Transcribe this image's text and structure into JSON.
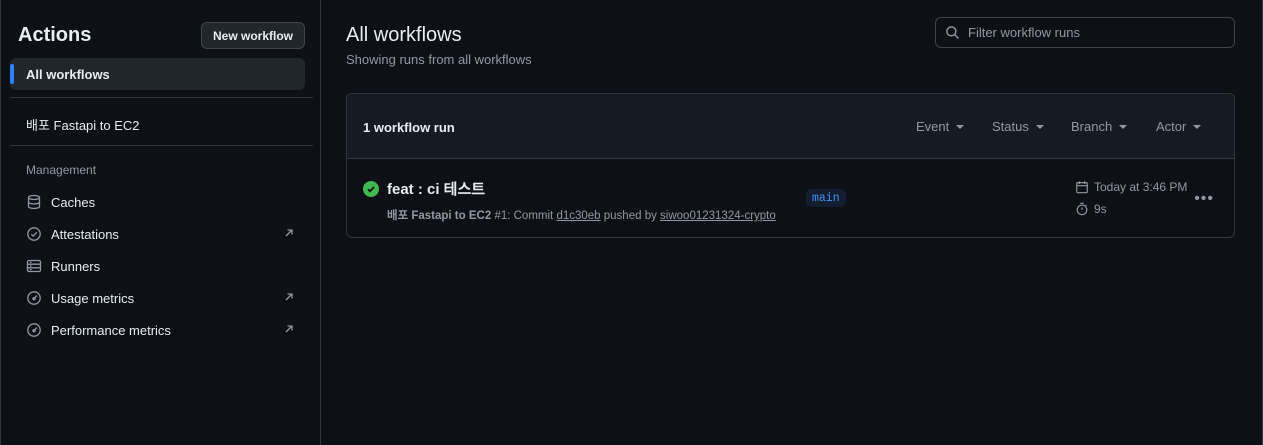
{
  "sidebar": {
    "title": "Actions",
    "new_workflow_label": "New workflow",
    "all_workflows_label": "All workflows",
    "workflows": [
      {
        "label": "배포 Fastapi to EC2"
      }
    ],
    "management_label": "Management",
    "management_items": [
      {
        "label": "Caches",
        "icon": "database-icon",
        "external": false
      },
      {
        "label": "Attestations",
        "icon": "verified-icon",
        "external": true
      },
      {
        "label": "Runners",
        "icon": "server-icon",
        "external": false
      },
      {
        "label": "Usage metrics",
        "icon": "meter-icon",
        "external": true
      },
      {
        "label": "Performance metrics",
        "icon": "meter-icon",
        "external": true
      }
    ]
  },
  "main": {
    "title": "All workflows",
    "subtitle": "Showing runs from all workflows",
    "filter_placeholder": "Filter workflow runs",
    "runs_count": "1 workflow run",
    "filters": [
      "Event",
      "Status",
      "Branch",
      "Actor"
    ],
    "runs": [
      {
        "title": "feat : ci 테스트",
        "workflow": "배포 Fastapi to EC2",
        "run_text": "#1: Commit",
        "commit": "d1c30eb",
        "pushed_by": "pushed by",
        "actor": "siwoo01231324-crypto",
        "branch": "main",
        "time": "Today at 3:46 PM",
        "duration": "9s",
        "status": "success"
      }
    ]
  },
  "colors": {
    "background": "#0d1117",
    "accent": "#2f81f7",
    "success": "#3fb950",
    "border": "#30363d"
  }
}
